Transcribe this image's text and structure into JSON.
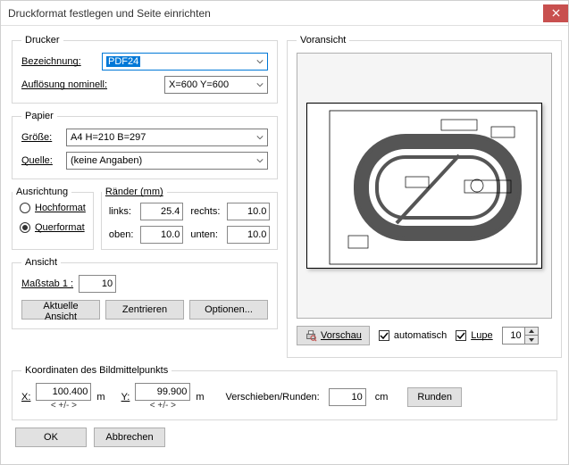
{
  "window": {
    "title": "Druckformat festlegen und Seite einrichten"
  },
  "printer": {
    "legend": "Drucker",
    "name_label": "Bezeichnung:",
    "name_value": "PDF24",
    "res_label": "Auflösung nominell:",
    "res_value": "X=600 Y=600"
  },
  "paper": {
    "legend": "Papier",
    "size_label": "Größe:",
    "size_value": "A4 H=210 B=297",
    "source_label": "Quelle:",
    "source_value": "(keine Angaben)"
  },
  "orientation": {
    "legend": "Ausrichtung",
    "portrait": "Hochformat",
    "landscape": "Querformat"
  },
  "margins": {
    "legend": "Ränder (mm)",
    "left_label": "links:",
    "left": "25.4",
    "right_label": "rechts:",
    "right": "10.0",
    "top_label": "oben:",
    "top": "10.0",
    "bottom_label": "unten:",
    "bottom": "10.0"
  },
  "view": {
    "legend": "Ansicht",
    "scale_label": "Maßstab  1 :",
    "scale": "10",
    "btn_current": "Aktuelle Ansicht",
    "btn_center": "Zentrieren",
    "btn_options": "Optionen..."
  },
  "preview": {
    "legend": "Voransicht",
    "btn_preview": "Vorschau",
    "chk_auto": "automatisch",
    "chk_loupe": "Lupe",
    "loupe_val": "10"
  },
  "coords": {
    "legend": "Koordinaten des Bildmittelpunkts",
    "x_label": "X:",
    "x": "100.400",
    "y_label": "Y:",
    "y": "99.900",
    "unit": "m",
    "pm": "< +/- >",
    "shift_label": "Verschieben/Runden:",
    "shift": "10",
    "shift_unit": "cm",
    "btn_round": "Runden"
  },
  "footer": {
    "ok": "OK",
    "cancel": "Abbrechen"
  }
}
